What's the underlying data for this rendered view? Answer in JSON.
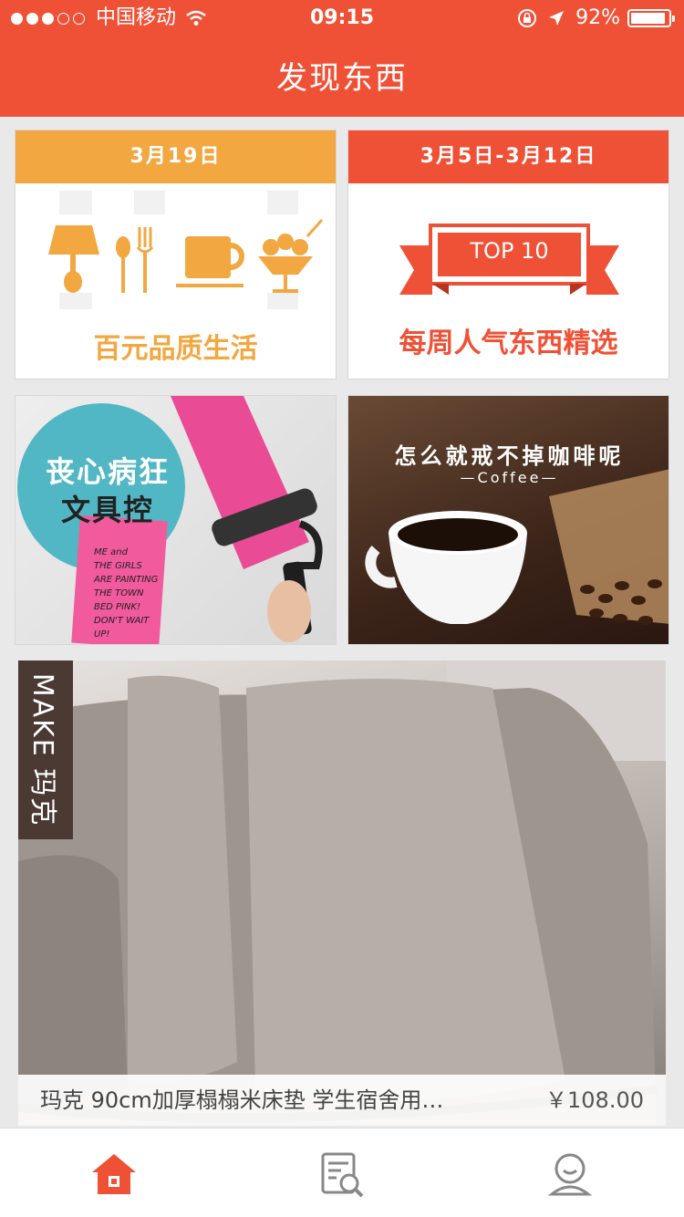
{
  "status_bar": {
    "carrier": "中国移动",
    "time": "09:15",
    "battery": "92%",
    "battery_level": 0.92
  },
  "nav": {
    "title": "发现东西"
  },
  "cards": [
    {
      "date": "3月19日",
      "caption": "百元品质生活",
      "head_color": "#f2a741",
      "caption_color": "#f2a741"
    },
    {
      "date": "3月5日-3月12日",
      "badge": "TOP 10",
      "caption": "每周人气东西精选",
      "head_color": "#ef5136",
      "caption_color": "#ef5136"
    },
    {
      "title_line1": "丧心病狂",
      "title_line2": "文具控",
      "tape_text": [
        "ME and",
        "THE GIRLS",
        "ARE PAINTING",
        "THE TOWN",
        "BED PINK!",
        "DON'T WAIT",
        "UP!"
      ]
    },
    {
      "title": "怎么就戒不掉咖啡呢",
      "subtitle": "—Coffee—"
    }
  ],
  "feature": {
    "brand": "MAKE 玛克",
    "title": "玛克 90cm加厚榻榻米床垫 学生宿舍用…",
    "price": "￥108.00"
  },
  "tabbar": {
    "icons": [
      "home-icon",
      "discover-icon",
      "profile-icon"
    ],
    "active_color": "#ef5136",
    "inactive_color": "#888888"
  }
}
